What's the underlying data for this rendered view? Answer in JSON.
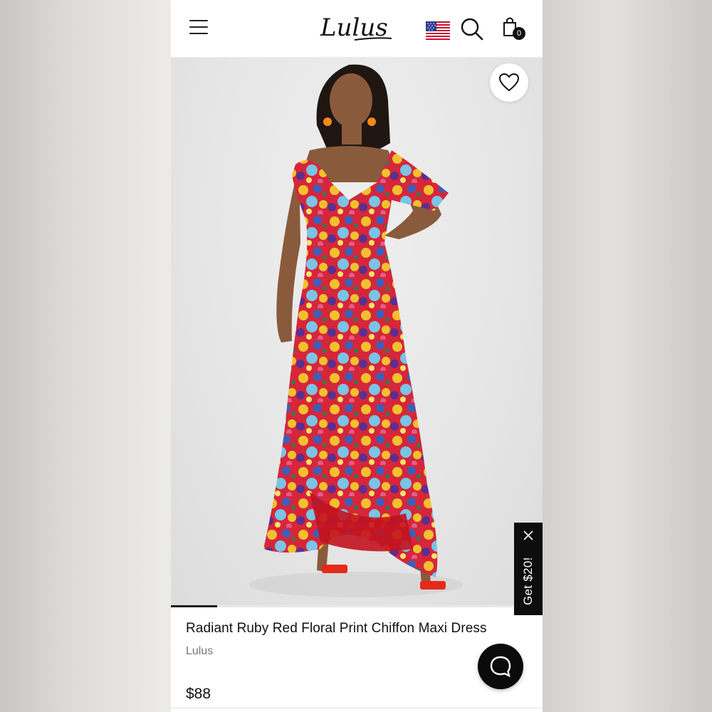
{
  "header": {
    "menu_icon": "hamburger-menu-icon",
    "logo_text": "Lulus",
    "flag_icon": "us-flag-icon",
    "search_icon": "search-icon",
    "bag_icon": "shopping-bag-icon",
    "bag_count": "0"
  },
  "gallery": {
    "wishlist_icon": "heart-icon",
    "progress_fraction": 0.125
  },
  "promo": {
    "label": "Get $20!",
    "close_icon": "close-icon"
  },
  "product": {
    "title": "Radiant Ruby Red Floral Print Chiffon Maxi Dress",
    "brand": "Lulus",
    "price": "$88"
  },
  "chat": {
    "icon": "chat-bubble-icon"
  },
  "colors": {
    "accent": "#0d0d0d",
    "dress_red": "#d6263a",
    "dress_yellow": "#f2c12e",
    "dress_blue": "#3d5fb8"
  }
}
